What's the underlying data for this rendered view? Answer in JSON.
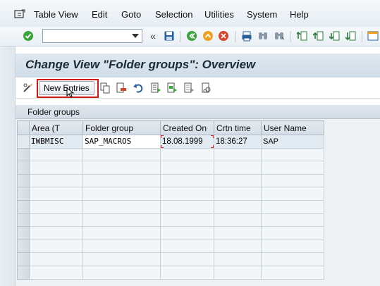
{
  "menubar": {
    "icon": "menu-icon",
    "items": [
      "Table View",
      "Edit",
      "Goto",
      "Selection",
      "Utilities",
      "System",
      "Help"
    ]
  },
  "toolbar": {
    "command_value": "",
    "nav_label": "«",
    "icons": [
      "enter-check-icon",
      "save-icon",
      "back-icon",
      "exit-icon",
      "cancel-icon",
      "print-icon",
      "find-icon",
      "find-next-icon",
      "first-page-icon",
      "prev-page-icon",
      "next-page-icon",
      "last-page-icon",
      "create-session-icon"
    ]
  },
  "title": "Change View \"Folder groups\": Overview",
  "app_toolbar": {
    "new_entries_label": "New Entries",
    "icons": [
      "display-change-icon",
      "copy-as-icon",
      "delete-icon",
      "undo-change-icon",
      "select-all-icon",
      "select-block-icon",
      "deselect-all-icon",
      "print-field-list-icon"
    ]
  },
  "table": {
    "title": "Folder groups",
    "columns": [
      "Area (T",
      "Folder group",
      "Created On",
      "Crtn time",
      "User Name"
    ],
    "rows": [
      [
        "IWBMISC",
        "SAP_MACROS",
        "18.08.1999",
        "18:36:27",
        "SAP"
      ]
    ],
    "empty_rows": 10
  },
  "colors": {
    "title_bg": "#d5e0ea",
    "highlight": "#d01818",
    "accent_green": "#3aa33a"
  }
}
